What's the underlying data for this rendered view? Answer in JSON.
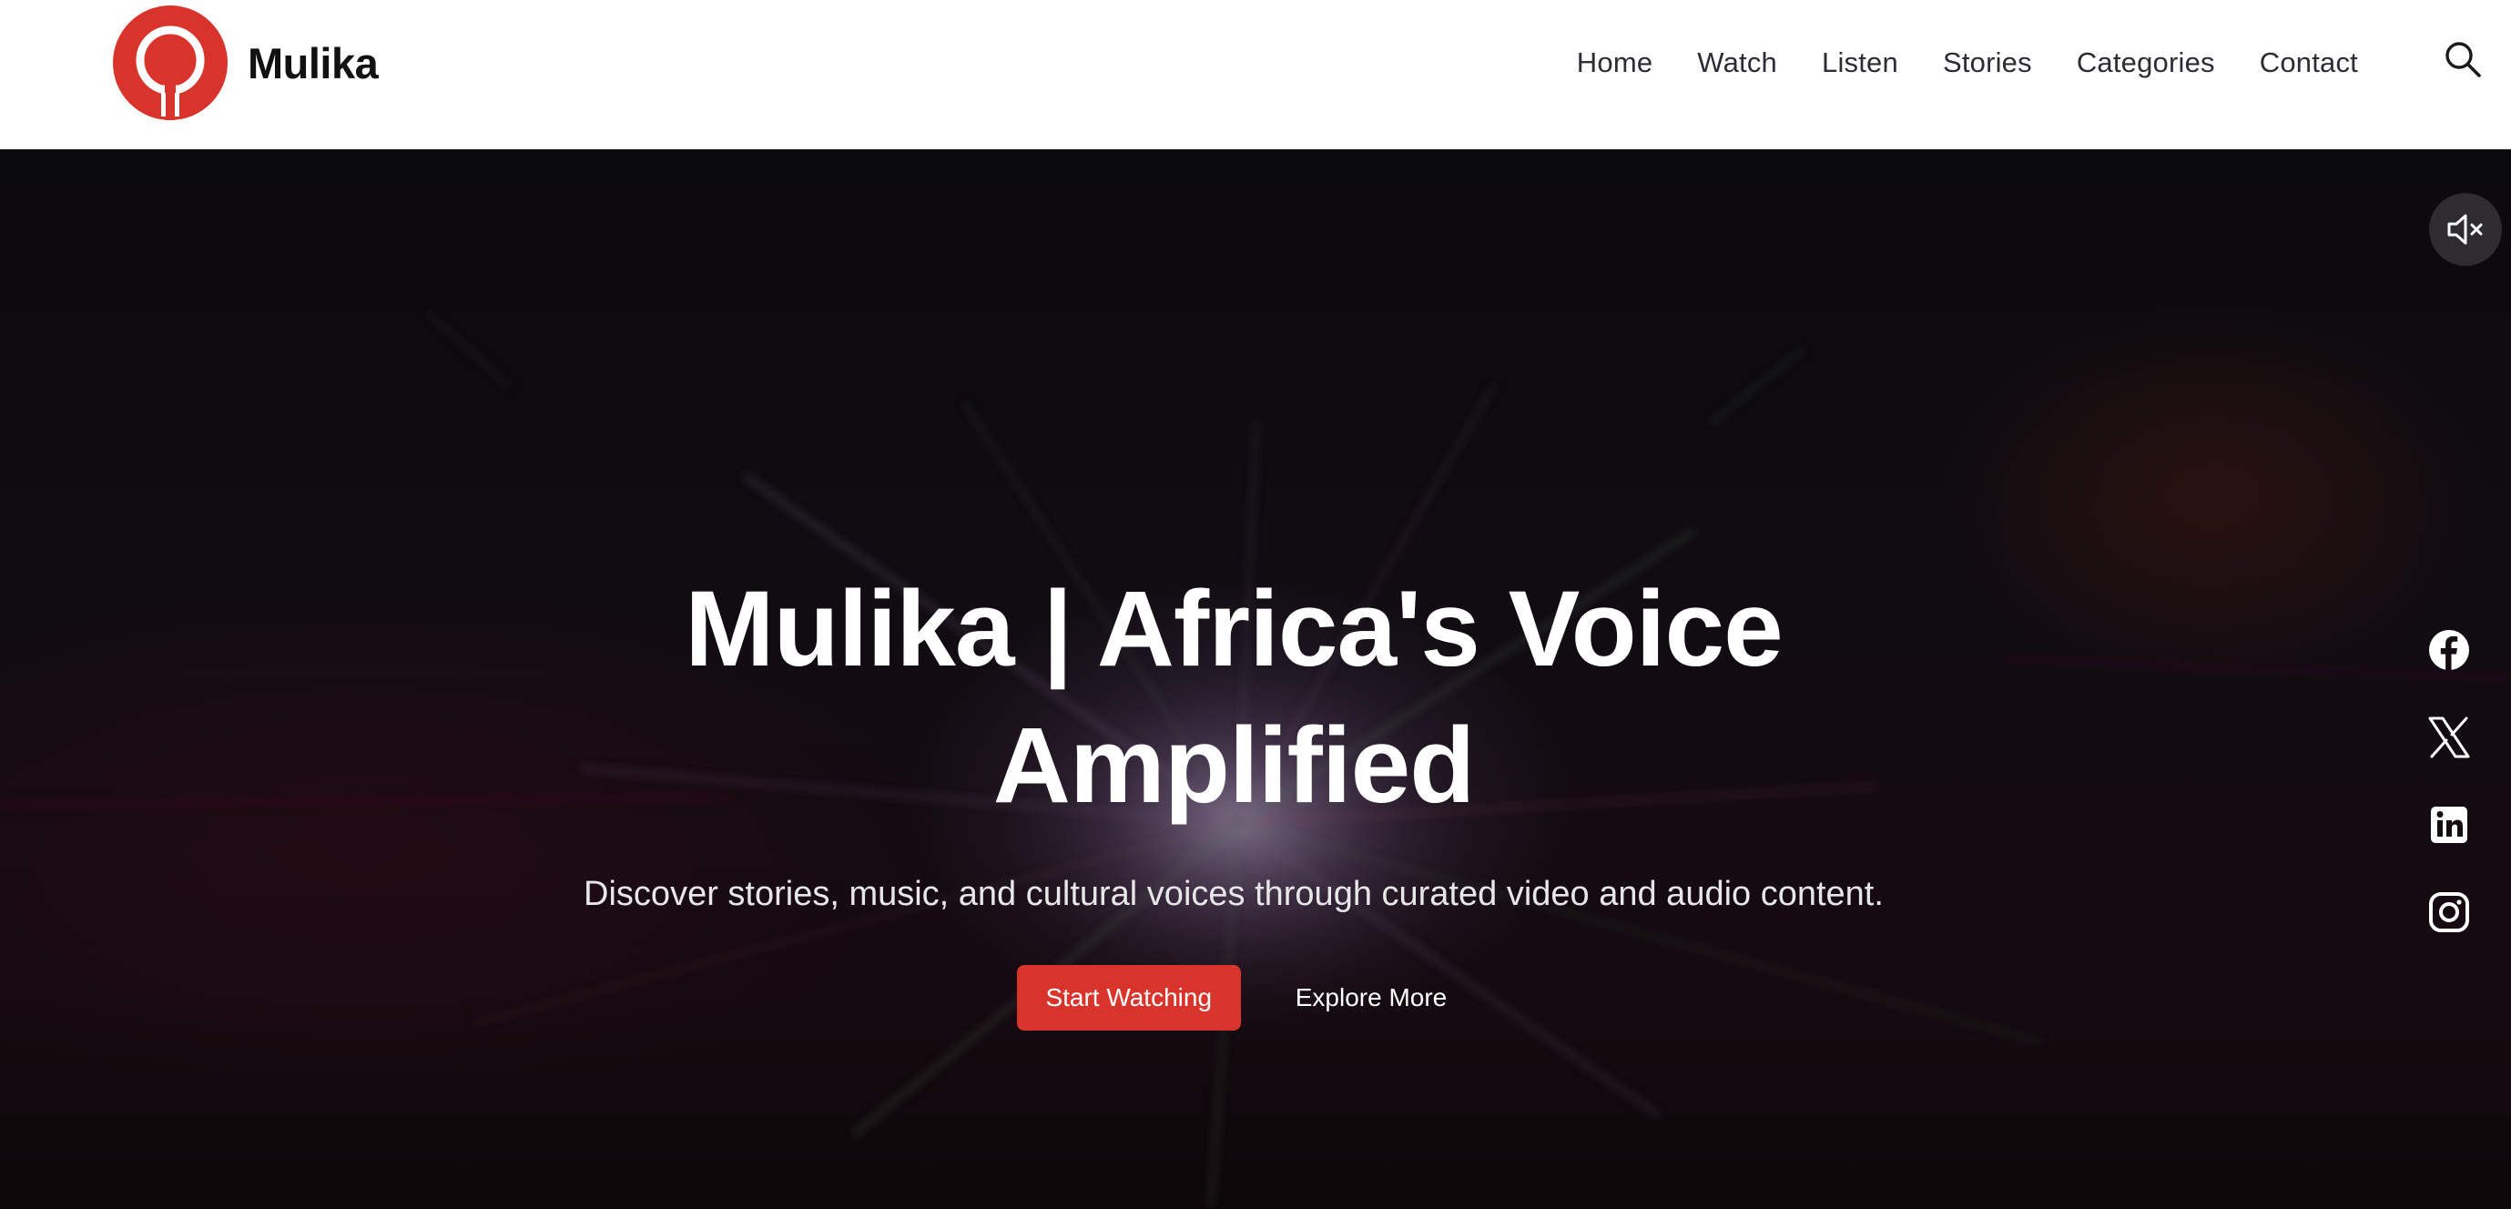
{
  "brand": {
    "name": "Mulika",
    "logo_icon": "microphone-logo-icon",
    "accent_color": "#d9342b"
  },
  "nav": {
    "items": [
      {
        "label": "Home"
      },
      {
        "label": "Watch"
      },
      {
        "label": "Listen"
      },
      {
        "label": "Stories"
      },
      {
        "label": "Categories"
      },
      {
        "label": "Contact"
      }
    ],
    "search_icon": "search-icon"
  },
  "hero": {
    "title": "Mulika | Africa's Voice Amplified",
    "subtitle": "Discover stories, music, and cultural voices through curated video and audio content.",
    "primary_cta": "Start Watching",
    "secondary_cta": "Explore More",
    "primary_color": "#d9342b"
  },
  "media": {
    "mute_icon": "speaker-muted-icon",
    "muted": true
  },
  "social": [
    {
      "name": "facebook-icon"
    },
    {
      "name": "x-icon"
    },
    {
      "name": "linkedin-icon"
    },
    {
      "name": "instagram-icon"
    }
  ]
}
